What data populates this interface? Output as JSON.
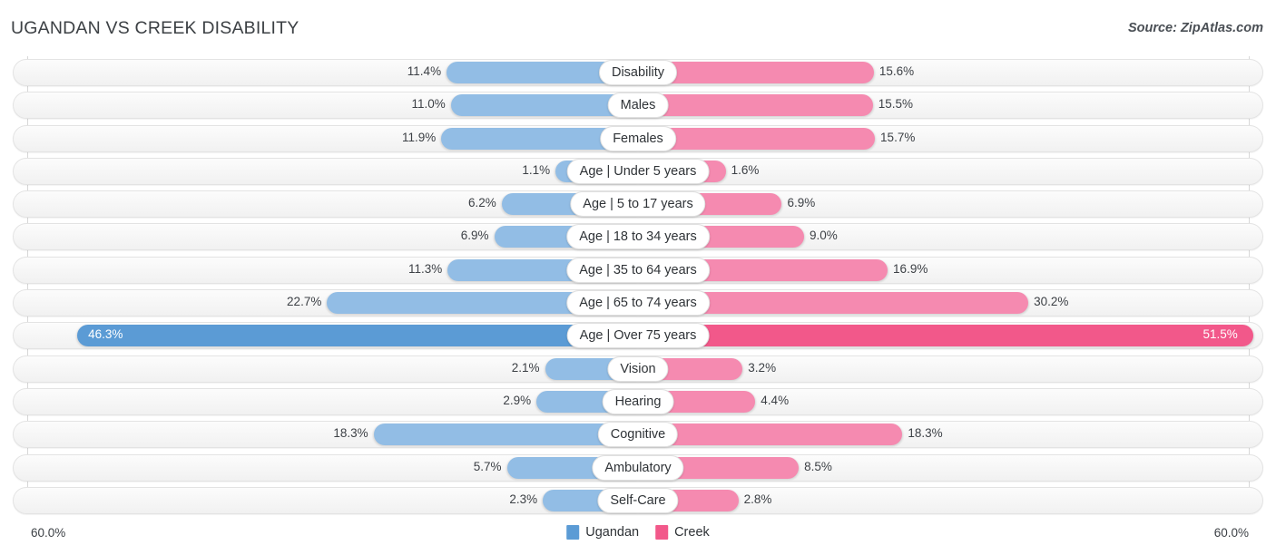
{
  "header": {
    "title": "UGANDAN VS CREEK DISABILITY",
    "source": "Source: ZipAtlas.com"
  },
  "axis": {
    "left_label": "60.0%",
    "right_label": "60.0%",
    "max": 60.0
  },
  "legend": {
    "items": [
      {
        "label": "Ugandan",
        "color": "#5b9bd5"
      },
      {
        "label": "Creek",
        "color": "#f2588a"
      }
    ]
  },
  "colors": {
    "left_normal": "#92bde5",
    "right_normal": "#f58ab0",
    "left_highlight": "#5b9bd5",
    "right_highlight": "#f2588a",
    "track": "#f7f7f7",
    "gridline": "#d8d8d8",
    "text": "#3d4146"
  },
  "chart_data": {
    "type": "bar",
    "subtype": "diverging-bidirectional",
    "title": "UGANDAN VS CREEK DISABILITY",
    "xlabel": "",
    "ylabel": "",
    "xlim": [
      60.0,
      60.0
    ],
    "grid": true,
    "legend_position": "bottom-center",
    "unit": "%",
    "categories": [
      "Disability",
      "Males",
      "Females",
      "Age | Under 5 years",
      "Age | 5 to 17 years",
      "Age | 18 to 34 years",
      "Age | 35 to 64 years",
      "Age | 65 to 74 years",
      "Age | Over 75 years",
      "Vision",
      "Hearing",
      "Cognitive",
      "Ambulatory",
      "Self-Care"
    ],
    "series": [
      {
        "name": "Ugandan",
        "side": "left",
        "color": "#92bde5",
        "values": [
          11.4,
          11.0,
          11.9,
          1.1,
          6.2,
          6.9,
          11.3,
          22.7,
          46.3,
          2.1,
          2.9,
          18.3,
          5.7,
          2.3
        ]
      },
      {
        "name": "Creek",
        "side": "right",
        "color": "#f58ab0",
        "values": [
          15.6,
          15.5,
          15.7,
          1.6,
          6.9,
          9.0,
          16.9,
          30.2,
          51.5,
          3.2,
          4.4,
          18.3,
          8.5,
          2.8
        ]
      }
    ],
    "highlighted_rows": [
      "Age | Over 75 years"
    ]
  },
  "rows": [
    {
      "label": "Disability",
      "left": "11.4%",
      "right": "15.6%",
      "left_value": 11.4,
      "right_value": 15.6,
      "highlight": false
    },
    {
      "label": "Males",
      "left": "11.0%",
      "right": "15.5%",
      "left_value": 11.0,
      "right_value": 15.5,
      "highlight": false
    },
    {
      "label": "Females",
      "left": "11.9%",
      "right": "15.7%",
      "left_value": 11.9,
      "right_value": 15.7,
      "highlight": false
    },
    {
      "label": "Age | Under 5 years",
      "left": "1.1%",
      "right": "1.6%",
      "left_value": 1.1,
      "right_value": 1.6,
      "highlight": false
    },
    {
      "label": "Age | 5 to 17 years",
      "left": "6.2%",
      "right": "6.9%",
      "left_value": 6.2,
      "right_value": 6.9,
      "highlight": false
    },
    {
      "label": "Age | 18 to 34 years",
      "left": "6.9%",
      "right": "9.0%",
      "left_value": 6.9,
      "right_value": 9.0,
      "highlight": false
    },
    {
      "label": "Age | 35 to 64 years",
      "left": "11.3%",
      "right": "16.9%",
      "left_value": 11.3,
      "right_value": 16.9,
      "highlight": false
    },
    {
      "label": "Age | 65 to 74 years",
      "left": "22.7%",
      "right": "30.2%",
      "left_value": 22.7,
      "right_value": 30.2,
      "highlight": false
    },
    {
      "label": "Age | Over 75 years",
      "left": "46.3%",
      "right": "51.5%",
      "left_value": 46.3,
      "right_value": 51.5,
      "highlight": true
    },
    {
      "label": "Vision",
      "left": "2.1%",
      "right": "3.2%",
      "left_value": 2.1,
      "right_value": 3.2,
      "highlight": false
    },
    {
      "label": "Hearing",
      "left": "2.9%",
      "right": "4.4%",
      "left_value": 2.9,
      "right_value": 4.4,
      "highlight": false
    },
    {
      "label": "Cognitive",
      "left": "18.3%",
      "right": "18.3%",
      "left_value": 18.3,
      "right_value": 18.3,
      "highlight": false
    },
    {
      "label": "Ambulatory",
      "left": "5.7%",
      "right": "8.5%",
      "left_value": 5.7,
      "right_value": 8.5,
      "highlight": false
    },
    {
      "label": "Self-Care",
      "left": "2.3%",
      "right": "2.8%",
      "left_value": 2.3,
      "right_value": 2.8,
      "highlight": false
    }
  ]
}
